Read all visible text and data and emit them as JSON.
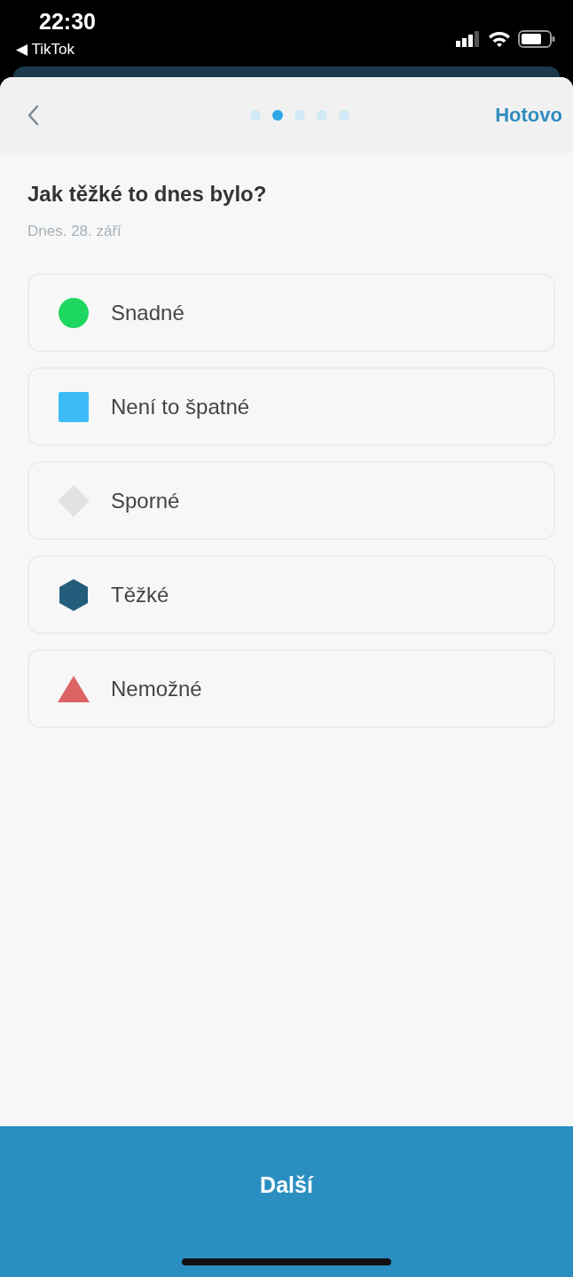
{
  "status_bar": {
    "time": "22:30",
    "back_app": "◀ TikTok"
  },
  "header": {
    "pages": [
      {
        "selected": false
      },
      {
        "selected": true
      },
      {
        "selected": false
      },
      {
        "selected": false
      },
      {
        "selected": false
      }
    ],
    "done": "Hotovo"
  },
  "question": "Jak těžké to dnes bylo?",
  "date": "Dnes. 28. září",
  "options": [
    {
      "kind": "circle",
      "color": "#1ed760",
      "label": "Snadné"
    },
    {
      "kind": "square",
      "color": "#3bbcf7",
      "label": "Není to špatné"
    },
    {
      "kind": "diamond",
      "color": "#e2e2e2",
      "label": "Sporné"
    },
    {
      "kind": "hexagon",
      "color": "#245d7c",
      "label": "Těžké"
    },
    {
      "kind": "triangle",
      "color": "#dc6464",
      "label": "Nemožné"
    }
  ],
  "next_button": "Další"
}
